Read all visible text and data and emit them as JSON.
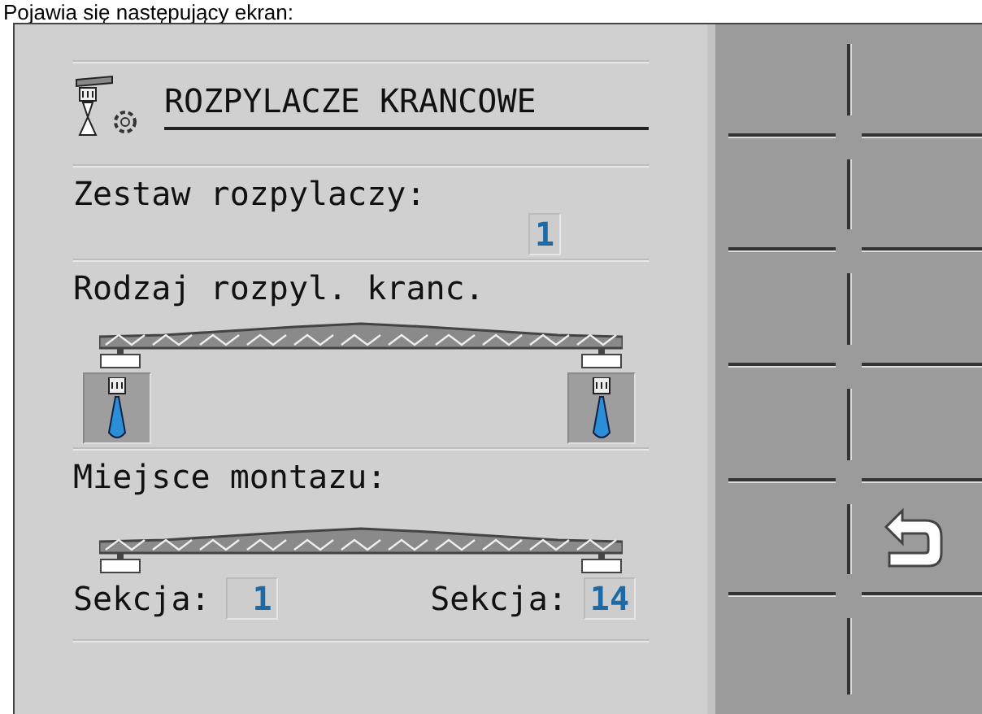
{
  "caption": "Pojawia się następujący ekran:",
  "title": "ROZPYLACZE KRANCOWE",
  "nozzle_set": {
    "label": "Zestaw rozpylaczy:",
    "value": "1"
  },
  "end_nozzle_type": {
    "label": "Rodzaj rozpyl. kranc.",
    "nozzles": [
      {
        "kind": "nozzle"
      },
      {
        "kind": "nozzle"
      }
    ]
  },
  "mounting": {
    "label": "Miejsce montazu:",
    "sections": [
      {
        "label": "Sekcja:",
        "value": "1"
      },
      {
        "label": "Sekcja:",
        "value": "14"
      }
    ]
  },
  "softkeys": [
    {
      "kind": "empty"
    },
    {
      "kind": "empty"
    },
    {
      "kind": "empty"
    },
    {
      "kind": "empty"
    },
    {
      "kind": "empty"
    },
    {
      "kind": "empty"
    },
    {
      "kind": "empty"
    },
    {
      "kind": "empty"
    },
    {
      "kind": "empty"
    },
    {
      "kind": "back"
    },
    {
      "kind": "empty"
    },
    {
      "kind": "empty"
    }
  ]
}
